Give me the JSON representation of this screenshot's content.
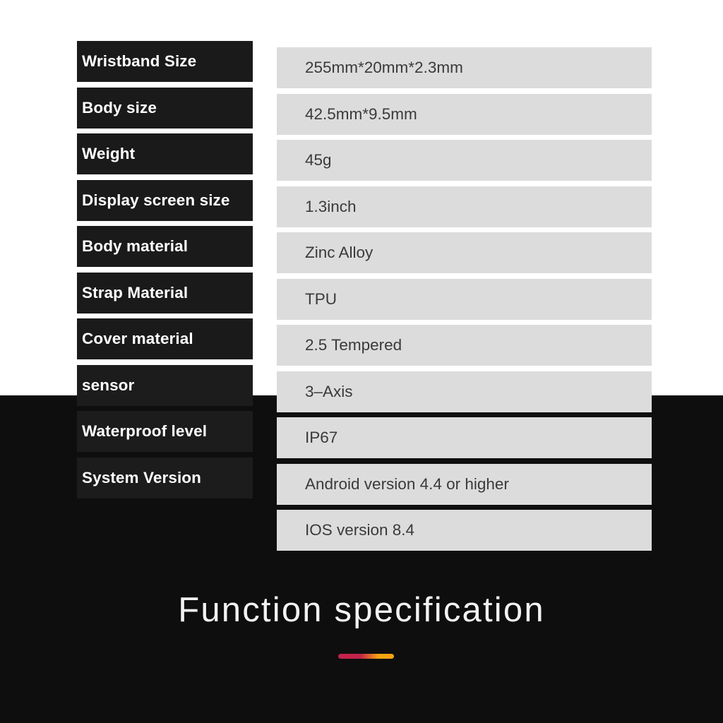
{
  "theme": {
    "page_background_light": "#ffffff",
    "page_background_dark": "#0e0e0e",
    "label_background": "#1a1a1a",
    "label_text_color": "#ffffff",
    "value_background": "#dcdcdc",
    "value_text_color": "#3a3a3a",
    "accent_gradient_start": "#c2234b",
    "accent_gradient_end": "#f5a312"
  },
  "spec_table": {
    "rows": [
      {
        "label": "Wristband Size",
        "value": "255mm*20mm*2.3mm"
      },
      {
        "label": "Body size",
        "value": "42.5mm*9.5mm"
      },
      {
        "label": "Weight",
        "value": "45g"
      },
      {
        "label": "Display screen size",
        "value": "1.3inch"
      },
      {
        "label": "Body material",
        "value": "Zinc Alloy"
      },
      {
        "label": "Strap Material",
        "value": "TPU"
      },
      {
        "label": "Cover material",
        "value": "2.5 Tempered"
      },
      {
        "label": "sensor",
        "value": "3–Axis"
      },
      {
        "label": "Waterproof level",
        "value": "IP67"
      },
      {
        "label": "System Version",
        "value": "Android version 4.4 or higher"
      },
      {
        "label": "",
        "value": "IOS version 8.4"
      }
    ]
  },
  "footer": {
    "heading": "Function specification"
  }
}
